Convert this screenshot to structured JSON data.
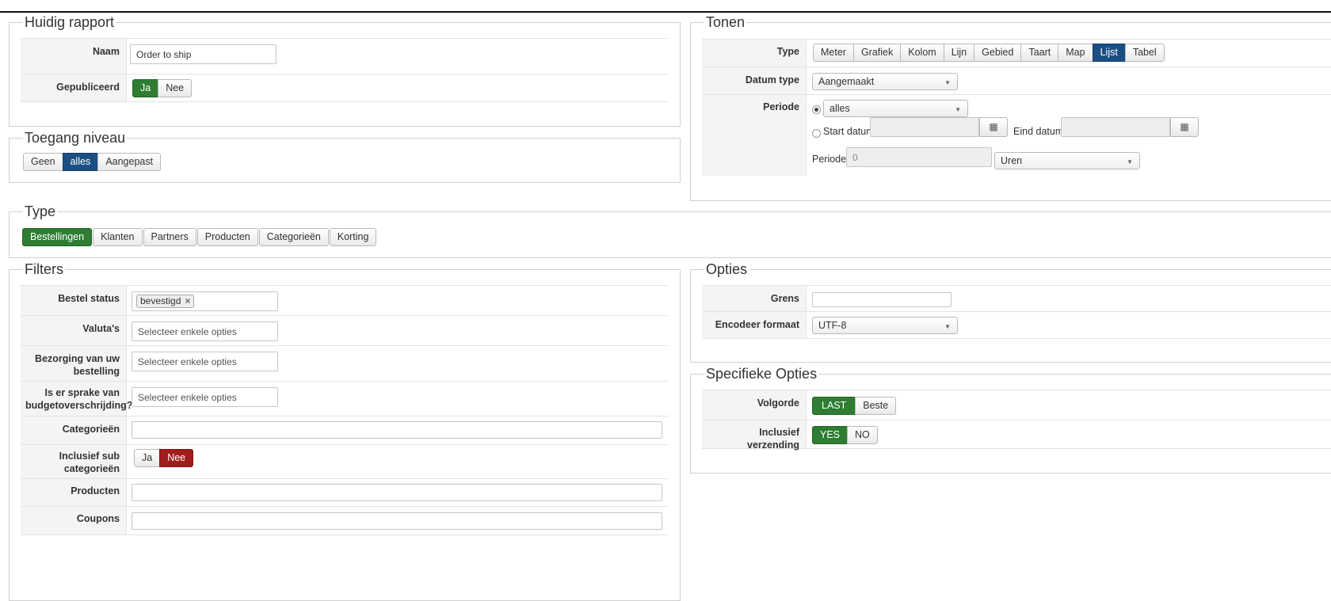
{
  "huidig_rapport": {
    "legend": "Huidig rapport",
    "naam_label": "Naam",
    "naam_value": "Order to ship",
    "gepubliceerd_label": "Gepubliceerd",
    "gepubliceerd_ja": "Ja",
    "gepubliceerd_nee": "Nee"
  },
  "toegang": {
    "legend": "Toegang niveau",
    "options": [
      "Geen",
      "alles",
      "Aangepast"
    ],
    "selected": "alles"
  },
  "tonen": {
    "legend": "Tonen",
    "type_label": "Type",
    "type_options": [
      "Meter",
      "Grafiek",
      "Kolom",
      "Lijn",
      "Gebied",
      "Taart",
      "Map",
      "Lijst",
      "Tabel"
    ],
    "type_selected": "Lijst",
    "datum_type_label": "Datum type",
    "datum_type_value": "Aangemaakt",
    "periode_label": "Periode",
    "periode_value": "alles",
    "start_datum_label": "Start datum",
    "eind_datum_label": "Eind datum",
    "periode2_label": "Periode",
    "periode2_value": "0",
    "unit_value": "Uren"
  },
  "type": {
    "legend": "Type",
    "options": [
      "Bestellingen",
      "Klanten",
      "Partners",
      "Producten",
      "Categorieën",
      "Korting"
    ],
    "selected": "Bestellingen"
  },
  "filters": {
    "legend": "Filters",
    "bestel_status_label": "Bestel status",
    "bestel_status_tag": "bevestigd",
    "valutas_label": "Valuta's",
    "bezorging_label": "Bezorging van uw bestelling",
    "budget_label": "Is er sprake van budgetoverschrijding?",
    "placeholder": "Selecteer enkele opties",
    "categorieen_label": "Categorieën",
    "inclusief_sub_label": "Inclusief sub categorieën",
    "inclusief_sub_ja": "Ja",
    "inclusief_sub_nee": "Nee",
    "producten_label": "Producten",
    "coupons_label": "Coupons"
  },
  "opties": {
    "legend": "Opties",
    "grens_label": "Grens",
    "encodeer_label": "Encodeer formaat",
    "encodeer_value": "UTF-8"
  },
  "specifieke": {
    "legend": "Specifieke Opties",
    "volgorde_label": "Volgorde",
    "volgorde_last": "LAST",
    "volgorde_beste": "Beste",
    "verzending_label": "Inclusief verzending",
    "verzending_yes": "YES",
    "verzending_no": "NO"
  },
  "colors": {
    "green": "#2e7d32",
    "blue": "#1b4f84",
    "red": "#a11c1c"
  }
}
